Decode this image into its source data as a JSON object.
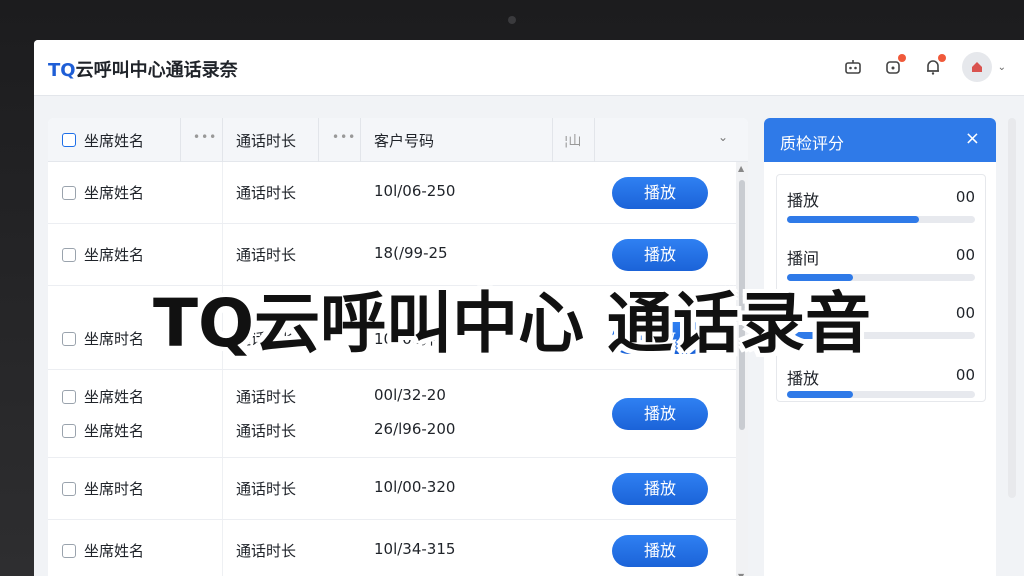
{
  "app": {
    "title_prefix": "TQ",
    "title_rest": "云呼叫中心通话录奈"
  },
  "header_icons": [
    "robot-icon",
    "notification-badge-icon",
    "bell-icon",
    "user-avatar"
  ],
  "table": {
    "headers": {
      "agent": "坐席姓名",
      "duration": "通话时长",
      "phone": "客户号码",
      "col4": "¦山"
    },
    "rows": [
      {
        "agent": "坐席姓名",
        "duration": "通话时长",
        "phone": "10l/06-250",
        "play": "播放"
      },
      {
        "agent": "坐席姓名",
        "duration": "通话时长",
        "phone": "18(/99-25",
        "play": "播放"
      },
      {
        "agent": "坐席时名",
        "duration": "通话时长",
        "phone": "10l/06弃l0",
        "play": "播放"
      },
      {
        "agent": "坐席姓名",
        "duration": "通话时长",
        "phone": "00l/32-20",
        "play": ""
      },
      {
        "agent": "坐席姓名",
        "duration": "通话时长",
        "phone": "26/l96-200",
        "play": "播放"
      },
      {
        "agent": "坐席时名",
        "duration": "通话时长",
        "phone": "10l/00-320",
        "play": "播放"
      },
      {
        "agent": "坐席姓名",
        "duration": "通话时长",
        "phone": "10l/34-315",
        "play": "播放"
      }
    ]
  },
  "panel": {
    "title": "质检评分",
    "close": "×",
    "scores": [
      {
        "label": "播放",
        "value": "00",
        "progress": 0.7
      },
      {
        "label": "播间",
        "value": "00",
        "progress": 0.35
      },
      {
        "label": "",
        "value": "00",
        "progress": 0.3
      },
      {
        "label": "播放",
        "value": "00",
        "progress": 0.35
      }
    ]
  },
  "overlay_text": "TQ云呼叫中心 通话录音",
  "colors": {
    "accent": "#1e6fe8",
    "play_button": "#1b63d8"
  }
}
